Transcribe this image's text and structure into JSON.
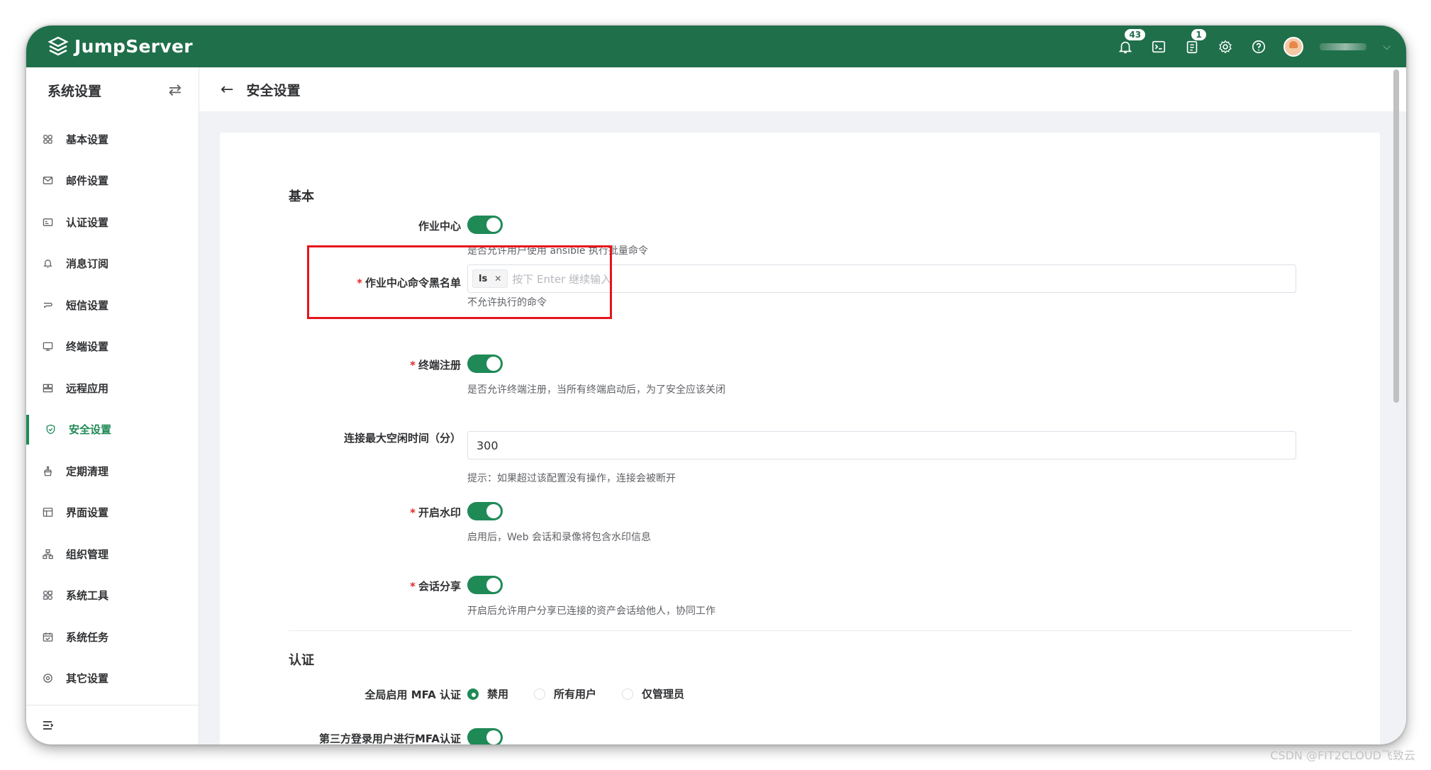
{
  "app": {
    "name": "JumpServer",
    "notifications_count": "43",
    "tickets_count": "1"
  },
  "sidebar": {
    "title": "系统设置",
    "items": [
      {
        "label": "基本设置",
        "icon": "grid-icon"
      },
      {
        "label": "邮件设置",
        "icon": "mail-icon"
      },
      {
        "label": "认证设置",
        "icon": "id-card-icon"
      },
      {
        "label": "消息订阅",
        "icon": "bell-icon"
      },
      {
        "label": "短信设置",
        "icon": "message-icon"
      },
      {
        "label": "终端设置",
        "icon": "monitor-icon"
      },
      {
        "label": "远程应用",
        "icon": "apps-icon"
      },
      {
        "label": "安全设置",
        "icon": "shield-icon",
        "active": true
      },
      {
        "label": "定期清理",
        "icon": "broom-icon"
      },
      {
        "label": "界面设置",
        "icon": "layout-icon"
      },
      {
        "label": "组织管理",
        "icon": "org-icon"
      },
      {
        "label": "系统工具",
        "icon": "tools-icon"
      },
      {
        "label": "系统任务",
        "icon": "calendar-icon"
      },
      {
        "label": "其它设置",
        "icon": "settings-icon"
      }
    ]
  },
  "page": {
    "title": "安全设置"
  },
  "form": {
    "basic_title": "基本",
    "job_center": {
      "label": "作业中心",
      "enabled": true,
      "help": "是否允许用户使用 ansible 执行批量命令"
    },
    "blacklist": {
      "label": "作业中心命令黑名单",
      "tag": "ls",
      "placeholder": "按下 Enter 继续输入",
      "help": "不允许执行的命令"
    },
    "terminal_register": {
      "label": "终端注册",
      "enabled": true,
      "help": "是否允许终端注册，当所有终端启动后，为了安全应该关闭"
    },
    "idle_time": {
      "label": "连接最大空闲时间（分）",
      "value": "300",
      "help": "提示：如果超过该配置没有操作，连接会被断开"
    },
    "watermark": {
      "label": "开启水印",
      "enabled": true,
      "help": "启用后，Web 会话和录像将包含水印信息"
    },
    "session_share": {
      "label": "会话分享",
      "enabled": true,
      "help": "开启后允许用户分享已连接的资产会话给他人，协同工作"
    },
    "auth_title": "认证",
    "mfa": {
      "label": "全局启用 MFA 认证",
      "options": [
        "禁用",
        "所有用户",
        "仅管理员"
      ],
      "selected": "禁用"
    },
    "third_party_mfa": {
      "label": "第三方登录用户进行MFA认证",
      "enabled": true
    }
  },
  "watermark_text": "CSDN @FIT2CLOUD飞致云"
}
